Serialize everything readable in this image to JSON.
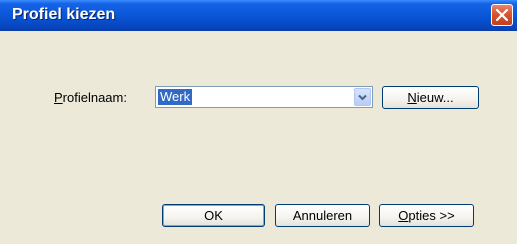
{
  "window": {
    "title": "Profiel kiezen"
  },
  "icons": {
    "close": "close-icon",
    "dropdown": "chevron-down-icon"
  },
  "profile": {
    "label_mnemonic": "P",
    "label_rest": "rofielnaam:",
    "selected_value": "Werk"
  },
  "buttons": {
    "new_mnemonic": "N",
    "new_rest": "ieuw...",
    "ok": "OK",
    "cancel": "Annuleren",
    "options_mnemonic": "O",
    "options_rest": "pties >>"
  },
  "colors": {
    "titlebar": "#0a56d8",
    "dialog_bg": "#ece9d8",
    "selection": "#316ac5",
    "close_button": "#d8542f"
  }
}
